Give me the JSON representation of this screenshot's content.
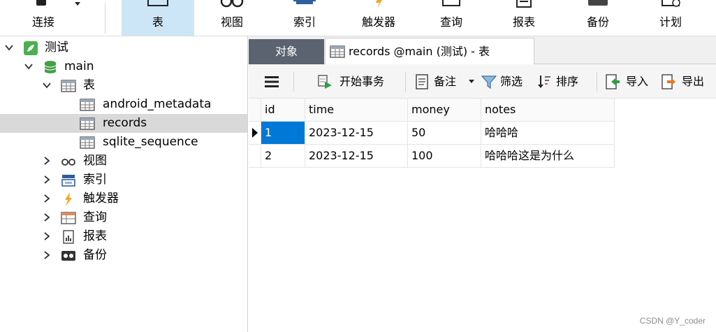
{
  "toolbar": {
    "items": [
      {
        "label": "连接",
        "icon": "plug-icon"
      },
      {
        "label": "表",
        "icon": "table-icon",
        "active": true
      },
      {
        "label": "视图",
        "icon": "glasses-icon"
      },
      {
        "label": "索引",
        "icon": "index-icon"
      },
      {
        "label": "触发器",
        "icon": "bolt-icon"
      },
      {
        "label": "查询",
        "icon": "query-icon"
      },
      {
        "label": "报表",
        "icon": "report-icon"
      },
      {
        "label": "备份",
        "icon": "backup-icon"
      },
      {
        "label": "计划",
        "icon": "schedule-icon"
      }
    ]
  },
  "tree": {
    "connection": "测试",
    "database": "main",
    "tables_group": "表",
    "tables": [
      "android_metadata",
      "records",
      "sqlite_sequence"
    ],
    "groups": [
      "视图",
      "索引",
      "触发器",
      "查询",
      "报表",
      "备份"
    ]
  },
  "tabs": {
    "objects": "对象",
    "records": "records @main (测试) - 表"
  },
  "subtoolbar": {
    "begin_transaction": "开始事务",
    "note": "备注",
    "filter": "筛选",
    "sort": "排序",
    "import": "导入",
    "export": "导出"
  },
  "grid": {
    "columns": [
      "id",
      "time",
      "money",
      "notes"
    ],
    "rows": [
      [
        "1",
        "2023-12-15",
        "50",
        "哈哈哈"
      ],
      [
        "2",
        "2023-12-15",
        "100",
        "哈哈哈这是为什么"
      ]
    ]
  },
  "watermark": "CSDN @Y_coder",
  "colors": {
    "selected_cell": "#0078d7",
    "active_tool": "#cde6f7",
    "objects_tab": "#5b6370",
    "connection_icon": "#4caf50",
    "database_icon": "#43a047",
    "trigger_icon": "#f5a623"
  }
}
